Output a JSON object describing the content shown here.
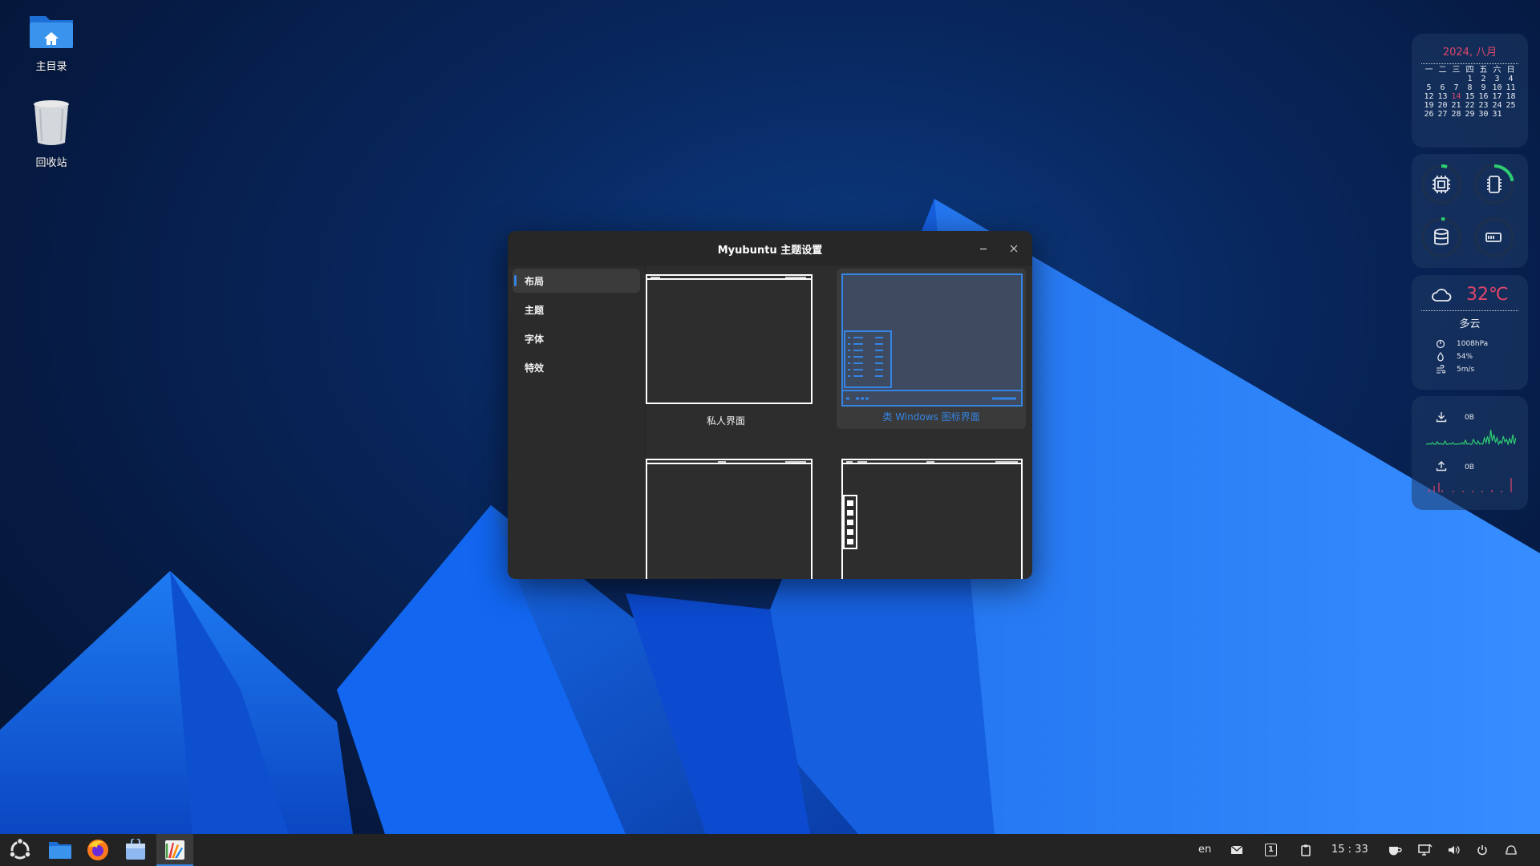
{
  "desktop": {
    "icons": [
      {
        "label": "主目录",
        "icon": "home-folder-icon"
      },
      {
        "label": "回收站",
        "icon": "trash-icon"
      }
    ]
  },
  "calendar": {
    "title": "2024, 八月",
    "weekdays": [
      "一",
      "二",
      "三",
      "四",
      "五",
      "六",
      "日"
    ],
    "weeks": [
      [
        "",
        "",
        "",
        "1",
        "2",
        "3",
        "4"
      ],
      [
        "5",
        "6",
        "7",
        "8",
        "9",
        "10",
        "11"
      ],
      [
        "12",
        "13",
        "14",
        "15",
        "16",
        "17",
        "18"
      ],
      [
        "19",
        "20",
        "21",
        "22",
        "23",
        "24",
        "25"
      ],
      [
        "26",
        "27",
        "28",
        "29",
        "30",
        "31",
        ""
      ]
    ],
    "today": "14",
    "accent": "#e0466c"
  },
  "system_monitor": {
    "gauges": [
      {
        "name": "cpu",
        "icon": "cpu-icon",
        "level": 0.05
      },
      {
        "name": "memory",
        "icon": "memory-icon",
        "level": 0.22
      },
      {
        "name": "disk",
        "icon": "disk-icon",
        "level": 0.03
      },
      {
        "name": "battery",
        "icon": "battery-icon",
        "level": 0.0
      }
    ],
    "gauge_color": "#2ecc71"
  },
  "weather": {
    "temperature": "32℃",
    "condition": "多云",
    "pressure": "1008hPa",
    "humidity": "54%",
    "wind": "5m/s",
    "icon": "cloud-icon"
  },
  "network": {
    "download": "0B",
    "upload": "0B",
    "download_color": "#2ecc71",
    "upload_color": "#e0466c"
  },
  "dialog": {
    "title": "Myubuntu 主题设置",
    "sidebar": [
      {
        "label": "布局",
        "active": true
      },
      {
        "label": "主题",
        "active": false
      },
      {
        "label": "字体",
        "active": false
      },
      {
        "label": "特效",
        "active": false
      }
    ],
    "layouts": [
      {
        "caption": "私人界面",
        "selected": false
      },
      {
        "caption": "类 Windows 图标界面",
        "selected": true
      },
      {
        "caption": "",
        "selected": false
      },
      {
        "caption": "",
        "selected": false
      }
    ],
    "accent": "#3584e4"
  },
  "taskbar": {
    "apps": [
      {
        "name": "ubuntu-menu",
        "icon": "ubuntu-logo-icon"
      },
      {
        "name": "files",
        "icon": "folder-icon"
      },
      {
        "name": "firefox",
        "icon": "firefox-icon"
      },
      {
        "name": "app-store",
        "icon": "store-icon"
      },
      {
        "name": "theme-settings",
        "icon": "theme-settings-icon",
        "active": true
      }
    ],
    "tray": {
      "language": "en",
      "workspace": "1",
      "clock": "15 : 33"
    }
  }
}
